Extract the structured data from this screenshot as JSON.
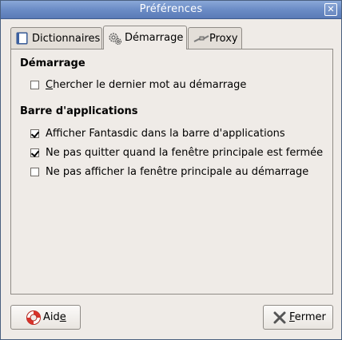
{
  "window": {
    "title": "Préférences",
    "close_glyph": "✕"
  },
  "tabs": [
    {
      "label": "Dictionnaires",
      "icon": "dictionary-icon",
      "active": false
    },
    {
      "label": "Démarrage",
      "icon": "gears-icon",
      "active": true
    },
    {
      "label": "Proxy",
      "icon": "network-plug-icon",
      "active": false
    }
  ],
  "startup_section": {
    "title": "Démarrage",
    "options": [
      {
        "mnemonic": "C",
        "rest": "hercher le dernier mot au démarrage",
        "checked": false
      }
    ]
  },
  "appbar_section": {
    "title": "Barre d'applications",
    "options": [
      {
        "label": "Afficher Fantasdic dans la barre d'applications",
        "checked": true
      },
      {
        "label": "Ne pas quitter quand la fenêtre principale est fermée",
        "checked": true
      },
      {
        "label": "Ne pas afficher la fenêtre principale au démarrage",
        "checked": false
      }
    ]
  },
  "buttons": {
    "help": {
      "prefix": "Aid",
      "mnemonic": "e",
      "icon": "lifebuoy-icon"
    },
    "close": {
      "mnemonic": "F",
      "rest": "ermer",
      "icon": "close-x-icon"
    }
  }
}
